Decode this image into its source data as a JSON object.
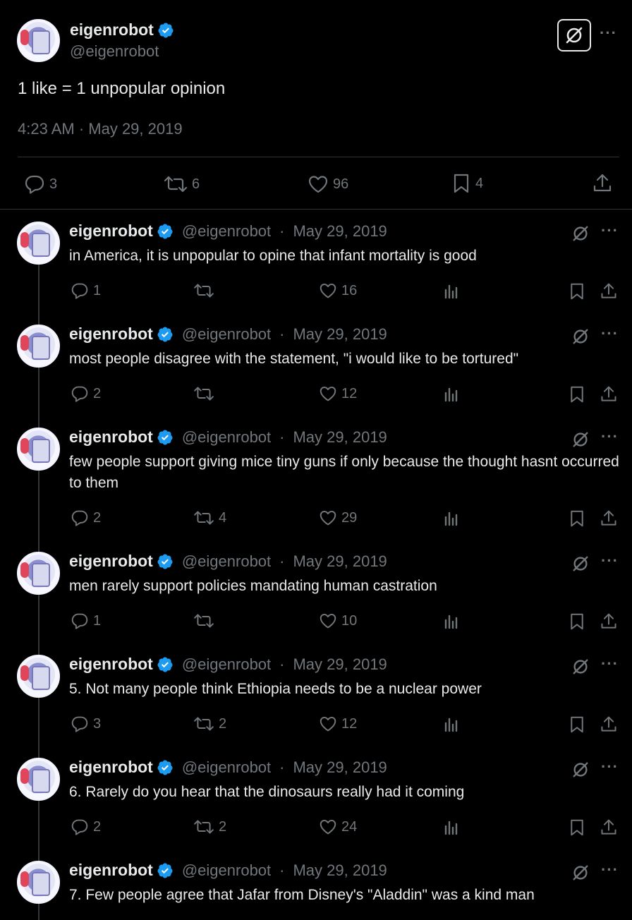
{
  "main": {
    "display_name": "eigenrobot",
    "handle": "@eigenrobot",
    "text": "1 like = 1 unpopular opinion",
    "timestamp": "4:23 AM · May 29, 2019",
    "more_icon": "···",
    "counts": {
      "replies": "3",
      "retweets": "6",
      "likes": "96",
      "bookmarks": "4"
    }
  },
  "replies": [
    {
      "display_name": "eigenrobot",
      "handle": "@eigenrobot",
      "date": "May 29, 2019",
      "text": "in America, it is unpopular to opine that infant mortality is good",
      "replies": "1",
      "retweets": "",
      "likes": "16"
    },
    {
      "display_name": "eigenrobot",
      "handle": "@eigenrobot",
      "date": "May 29, 2019",
      "text": "most people disagree with the statement, \"i would like to be tortured\"",
      "replies": "2",
      "retweets": "",
      "likes": "12"
    },
    {
      "display_name": "eigenrobot",
      "handle": "@eigenrobot",
      "date": "May 29, 2019",
      "text": "few people support giving mice tiny guns if only because the thought hasnt occurred to them",
      "replies": "2",
      "retweets": "4",
      "likes": "29"
    },
    {
      "display_name": "eigenrobot",
      "handle": "@eigenrobot",
      "date": "May 29, 2019",
      "text": "men rarely support policies mandating human castration",
      "replies": "1",
      "retweets": "",
      "likes": "10"
    },
    {
      "display_name": "eigenrobot",
      "handle": "@eigenrobot",
      "date": "May 29, 2019",
      "text": "5. Not many people think Ethiopia needs to be a nuclear power",
      "replies": "3",
      "retweets": "2",
      "likes": "12"
    },
    {
      "display_name": "eigenrobot",
      "handle": "@eigenrobot",
      "date": "May 29, 2019",
      "text": "6. Rarely do you hear that the dinosaurs really had it coming",
      "replies": "2",
      "retweets": "2",
      "likes": "24"
    },
    {
      "display_name": "eigenrobot",
      "handle": "@eigenrobot",
      "date": "May 29, 2019",
      "text": "7. Few people agree that Jafar from Disney's \"Aladdin\" was a kind man",
      "replies": "",
      "retweets": "",
      "likes": ""
    }
  ],
  "separator": " · ",
  "colors": {
    "background": "#000000",
    "text": "#e7e9ea",
    "muted": "#71767b",
    "verified": "#1d9bf0",
    "border": "#2f3336"
  },
  "icons": [
    "verified-badge-icon",
    "grok-icon",
    "more-icon",
    "reply-icon",
    "retweet-icon",
    "like-icon",
    "views-icon",
    "bookmark-icon",
    "share-icon"
  ]
}
